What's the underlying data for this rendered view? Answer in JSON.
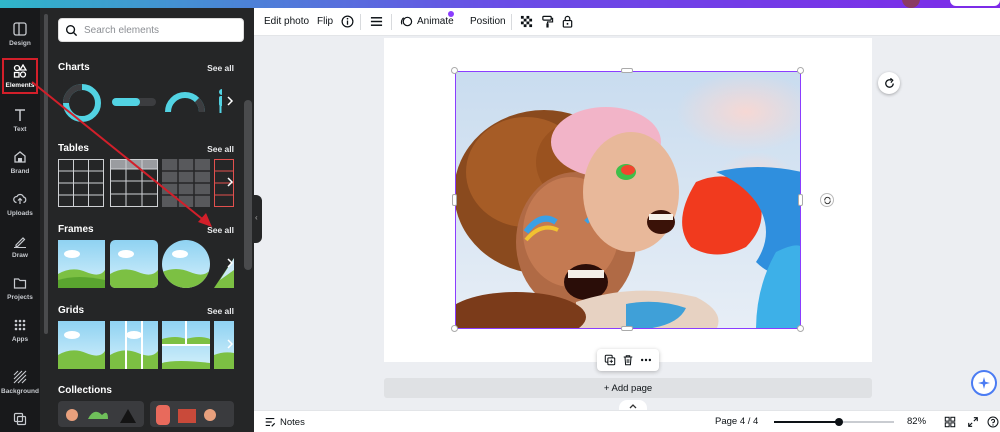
{
  "rail": {
    "items": [
      {
        "label": "Design",
        "icon": "layout-icon"
      },
      {
        "label": "Elements",
        "icon": "shapes-icon"
      },
      {
        "label": "Text",
        "icon": "text-icon"
      },
      {
        "label": "Brand",
        "icon": "brand-icon"
      },
      {
        "label": "Uploads",
        "icon": "upload-icon"
      },
      {
        "label": "Draw",
        "icon": "pen-icon"
      },
      {
        "label": "Projects",
        "icon": "folder-icon"
      },
      {
        "label": "Apps",
        "icon": "grid-icon"
      },
      {
        "label": "Background",
        "icon": "pattern-icon"
      }
    ],
    "active": "Elements"
  },
  "panel": {
    "search_placeholder": "Search elements",
    "sections": [
      {
        "title": "Charts",
        "see_all": "See all"
      },
      {
        "title": "Tables",
        "see_all": "See all"
      },
      {
        "title": "Frames",
        "see_all": "See all"
      },
      {
        "title": "Grids",
        "see_all": "See all"
      },
      {
        "title": "Collections"
      }
    ]
  },
  "toolbar": {
    "edit_photo": "Edit photo",
    "flip": "Flip",
    "animate": "Animate",
    "position": "Position"
  },
  "canvas": {
    "add_page": "+ Add page"
  },
  "bottombar": {
    "notes": "Notes",
    "page_indicator": "Page 4 / 4",
    "zoom": "82%",
    "zoom_fraction": 0.54
  },
  "colors": {
    "accent": "#8b3dff",
    "highlight": "#d21f2a",
    "rail_bg": "#18191b",
    "panel_bg": "#252627",
    "teal": "#52d3e3"
  }
}
